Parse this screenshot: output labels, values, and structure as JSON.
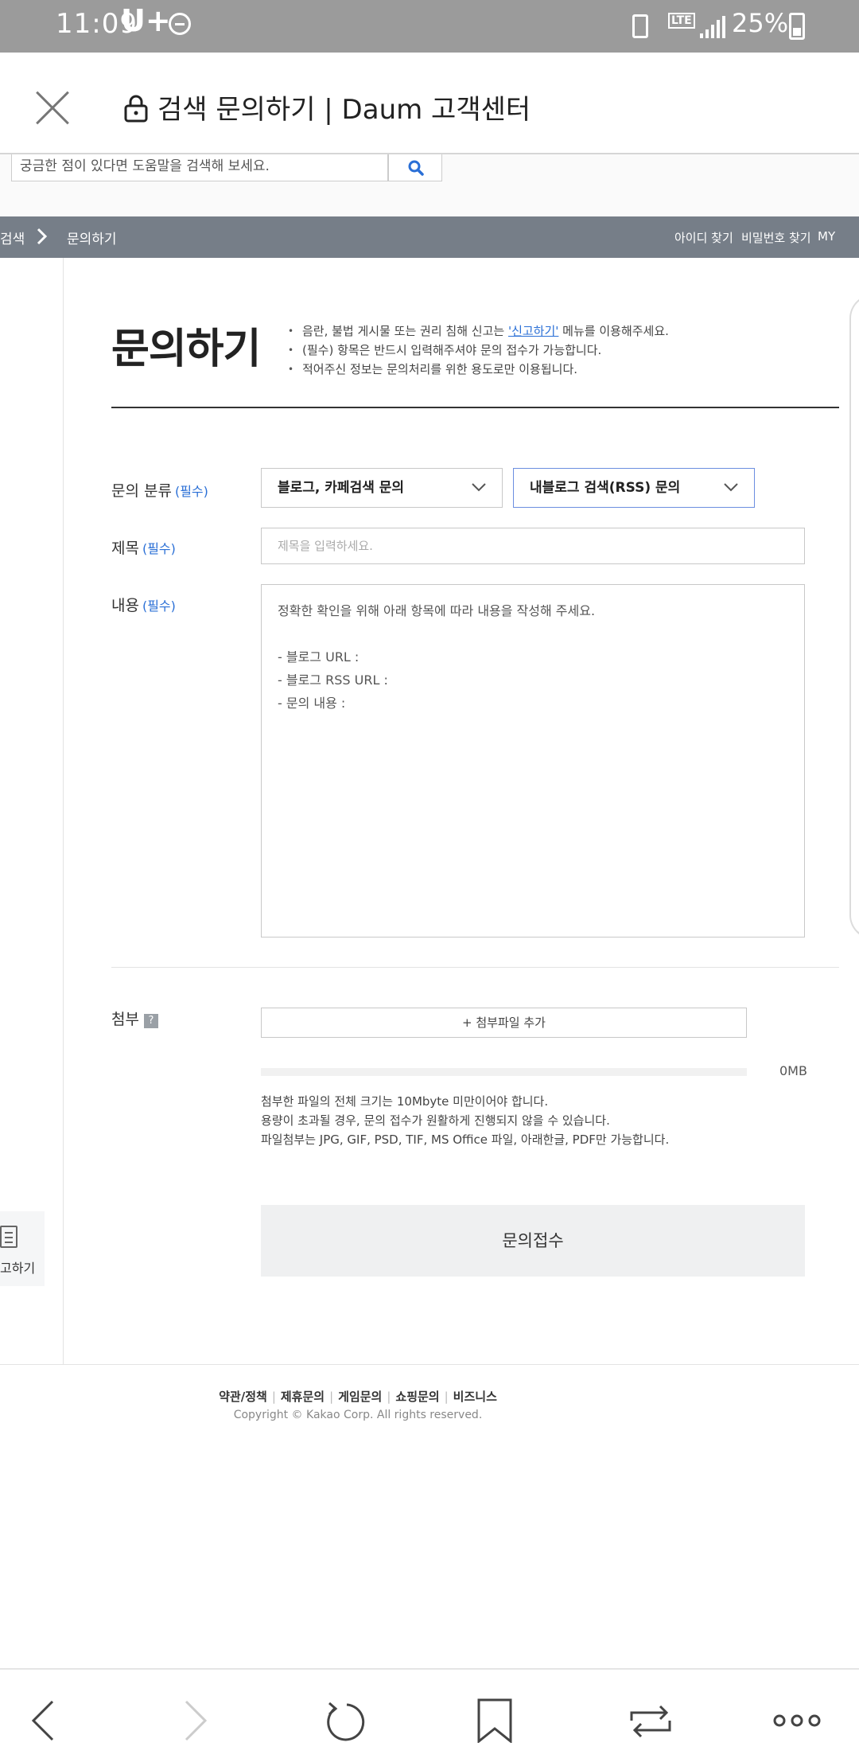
{
  "status_bar": {
    "time": "11:09",
    "carrier": "U+",
    "network": "LTE",
    "battery": "25%"
  },
  "browser": {
    "page_title": "검색 문의하기 | Daum 고객센터"
  },
  "search": {
    "placeholder": "궁금한 점이 있다면 도움말을 검색해 보세요."
  },
  "nav": {
    "breadcrumb_prev": "검색",
    "breadcrumb_current": "문의하기",
    "find_id": "아이디 찾기",
    "find_password": "비밀번호 찾기",
    "my": "MY"
  },
  "main": {
    "title": "문의하기",
    "notices": [
      {
        "before": "음란, 불법 게시물 또는 권리 침해 신고는 ",
        "link": "'신고하기'",
        "after": " 메뉴를 이용해주세요."
      },
      {
        "before": "(필수) 항목은 반드시 입력해주셔야 문의 접수가 가능합니다.",
        "link": "",
        "after": ""
      },
      {
        "before": "적어주신 정보는 문의처리를 위한 용도로만 이용됩니다.",
        "link": "",
        "after": ""
      }
    ]
  },
  "form": {
    "required_tag": "(필수)",
    "category_label": "문의 분류",
    "category_primary": "블로그, 카페검색 문의",
    "category_secondary": "내블로그 검색(RSS) 문의",
    "subject_label": "제목",
    "subject_placeholder": "제목을 입력하세요.",
    "content_label": "내용",
    "content_lines": [
      "정확한 확인을 위해 아래 항목에 따라 내용을 작성해 주세요.",
      "",
      "- 블로그 URL :",
      "- 블로그 RSS URL :",
      "- 문의 내용 :"
    ],
    "attach_label": "첨부",
    "attach_help": "?",
    "add_file": "+ 첨부파일 추가",
    "file_size": "0MB",
    "upload_progress": 0,
    "file_notes": [
      "첨부한 파일의 전체 크기는 10Mbyte 미만이어야 합니다.",
      "용량이 초과될 경우, 문의 접수가 원활하게 진행되지 않을 수 있습니다.",
      "파일첨부는 JPG, GIF, PSD, TIF, MS Office 파일, 아래한글, PDF만 가능합니다."
    ],
    "submit": "문의접수"
  },
  "side": {
    "report_label": "고하기"
  },
  "footer": {
    "links": [
      "약관/정책",
      "제휴문의",
      "게임문의",
      "쇼핑문의",
      "비즈니스"
    ],
    "copyright": "Copyright © Kakao Corp. All rights reserved."
  },
  "colors": {
    "accent": "#2a6fd6",
    "nav_bg": "#767e88",
    "status_bg": "#9b9b9b"
  }
}
